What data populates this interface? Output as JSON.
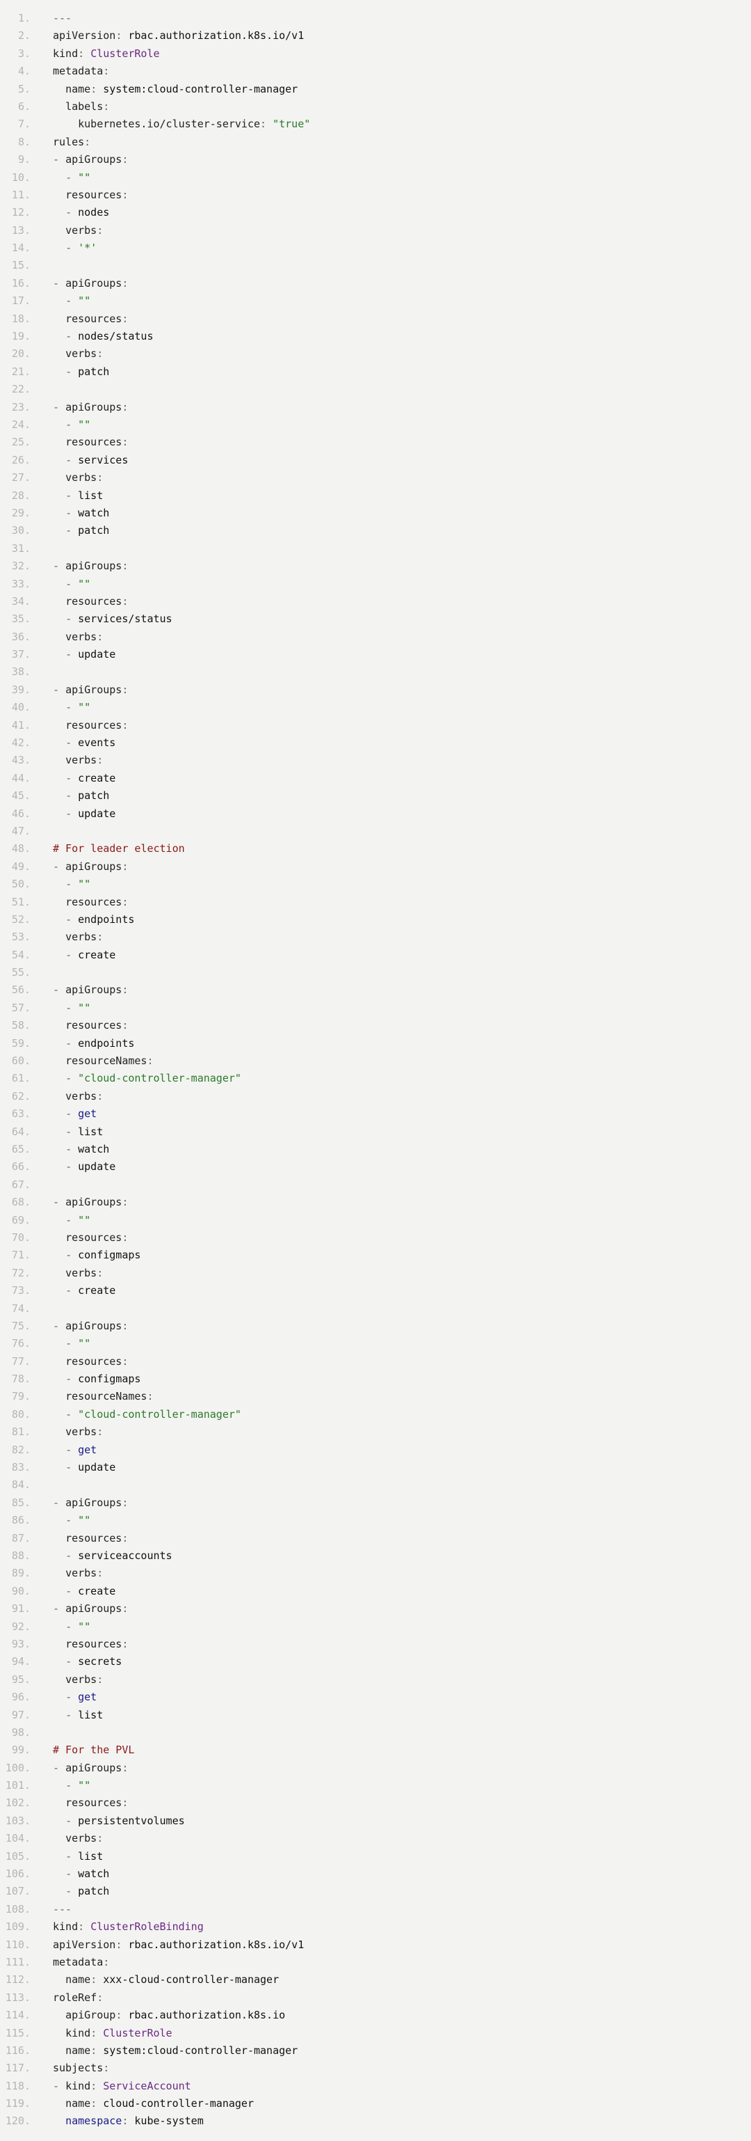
{
  "lines": [
    [
      [
        "punct",
        "---"
      ]
    ],
    [
      [
        "key",
        "apiVersion"
      ],
      [
        "punct",
        ": "
      ],
      [
        "plain",
        "rbac.authorization.k8s.io/v1"
      ]
    ],
    [
      [
        "key",
        "kind"
      ],
      [
        "punct",
        ": "
      ],
      [
        "type",
        "ClusterRole"
      ]
    ],
    [
      [
        "key",
        "metadata"
      ],
      [
        "punct",
        ":"
      ]
    ],
    [
      [
        "plain",
        "  "
      ],
      [
        "key",
        "name"
      ],
      [
        "punct",
        ": "
      ],
      [
        "plain",
        "system:cloud-controller-manager"
      ]
    ],
    [
      [
        "plain",
        "  "
      ],
      [
        "key",
        "labels"
      ],
      [
        "punct",
        ":"
      ]
    ],
    [
      [
        "plain",
        "    "
      ],
      [
        "key",
        "kubernetes.io/cluster-service"
      ],
      [
        "punct",
        ": "
      ],
      [
        "str",
        "\"true\""
      ]
    ],
    [
      [
        "key",
        "rules"
      ],
      [
        "punct",
        ":"
      ]
    ],
    [
      [
        "punct",
        "- "
      ],
      [
        "key",
        "apiGroups"
      ],
      [
        "punct",
        ":"
      ]
    ],
    [
      [
        "plain",
        "  "
      ],
      [
        "punct",
        "- "
      ],
      [
        "str",
        "\"\""
      ]
    ],
    [
      [
        "plain",
        "  "
      ],
      [
        "key",
        "resources"
      ],
      [
        "punct",
        ":"
      ]
    ],
    [
      [
        "plain",
        "  "
      ],
      [
        "punct",
        "- "
      ],
      [
        "plain",
        "nodes"
      ]
    ],
    [
      [
        "plain",
        "  "
      ],
      [
        "key",
        "verbs"
      ],
      [
        "punct",
        ":"
      ]
    ],
    [
      [
        "plain",
        "  "
      ],
      [
        "punct",
        "- "
      ],
      [
        "str",
        "'*'"
      ]
    ],
    [],
    [
      [
        "punct",
        "- "
      ],
      [
        "key",
        "apiGroups"
      ],
      [
        "punct",
        ":"
      ]
    ],
    [
      [
        "plain",
        "  "
      ],
      [
        "punct",
        "- "
      ],
      [
        "str",
        "\"\""
      ]
    ],
    [
      [
        "plain",
        "  "
      ],
      [
        "key",
        "resources"
      ],
      [
        "punct",
        ":"
      ]
    ],
    [
      [
        "plain",
        "  "
      ],
      [
        "punct",
        "- "
      ],
      [
        "plain",
        "nodes/status"
      ]
    ],
    [
      [
        "plain",
        "  "
      ],
      [
        "key",
        "verbs"
      ],
      [
        "punct",
        ":"
      ]
    ],
    [
      [
        "plain",
        "  "
      ],
      [
        "punct",
        "- "
      ],
      [
        "plain",
        "patch"
      ]
    ],
    [],
    [
      [
        "punct",
        "- "
      ],
      [
        "key",
        "apiGroups"
      ],
      [
        "punct",
        ":"
      ]
    ],
    [
      [
        "plain",
        "  "
      ],
      [
        "punct",
        "- "
      ],
      [
        "str",
        "\"\""
      ]
    ],
    [
      [
        "plain",
        "  "
      ],
      [
        "key",
        "resources"
      ],
      [
        "punct",
        ":"
      ]
    ],
    [
      [
        "plain",
        "  "
      ],
      [
        "punct",
        "- "
      ],
      [
        "plain",
        "services"
      ]
    ],
    [
      [
        "plain",
        "  "
      ],
      [
        "key",
        "verbs"
      ],
      [
        "punct",
        ":"
      ]
    ],
    [
      [
        "plain",
        "  "
      ],
      [
        "punct",
        "- "
      ],
      [
        "plain",
        "list"
      ]
    ],
    [
      [
        "plain",
        "  "
      ],
      [
        "punct",
        "- "
      ],
      [
        "plain",
        "watch"
      ]
    ],
    [
      [
        "plain",
        "  "
      ],
      [
        "punct",
        "- "
      ],
      [
        "plain",
        "patch"
      ]
    ],
    [],
    [
      [
        "punct",
        "- "
      ],
      [
        "key",
        "apiGroups"
      ],
      [
        "punct",
        ":"
      ]
    ],
    [
      [
        "plain",
        "  "
      ],
      [
        "punct",
        "- "
      ],
      [
        "str",
        "\"\""
      ]
    ],
    [
      [
        "plain",
        "  "
      ],
      [
        "key",
        "resources"
      ],
      [
        "punct",
        ":"
      ]
    ],
    [
      [
        "plain",
        "  "
      ],
      [
        "punct",
        "- "
      ],
      [
        "plain",
        "services/status"
      ]
    ],
    [
      [
        "plain",
        "  "
      ],
      [
        "key",
        "verbs"
      ],
      [
        "punct",
        ":"
      ]
    ],
    [
      [
        "plain",
        "  "
      ],
      [
        "punct",
        "- "
      ],
      [
        "plain",
        "update"
      ]
    ],
    [],
    [
      [
        "punct",
        "- "
      ],
      [
        "key",
        "apiGroups"
      ],
      [
        "punct",
        ":"
      ]
    ],
    [
      [
        "plain",
        "  "
      ],
      [
        "punct",
        "- "
      ],
      [
        "str",
        "\"\""
      ]
    ],
    [
      [
        "plain",
        "  "
      ],
      [
        "key",
        "resources"
      ],
      [
        "punct",
        ":"
      ]
    ],
    [
      [
        "plain",
        "  "
      ],
      [
        "punct",
        "- "
      ],
      [
        "plain",
        "events"
      ]
    ],
    [
      [
        "plain",
        "  "
      ],
      [
        "key",
        "verbs"
      ],
      [
        "punct",
        ":"
      ]
    ],
    [
      [
        "plain",
        "  "
      ],
      [
        "punct",
        "- "
      ],
      [
        "plain",
        "create"
      ]
    ],
    [
      [
        "plain",
        "  "
      ],
      [
        "punct",
        "- "
      ],
      [
        "plain",
        "patch"
      ]
    ],
    [
      [
        "plain",
        "  "
      ],
      [
        "punct",
        "- "
      ],
      [
        "plain",
        "update"
      ]
    ],
    [],
    [
      [
        "comment",
        "# For leader election"
      ]
    ],
    [
      [
        "punct",
        "- "
      ],
      [
        "key",
        "apiGroups"
      ],
      [
        "punct",
        ":"
      ]
    ],
    [
      [
        "plain",
        "  "
      ],
      [
        "punct",
        "- "
      ],
      [
        "str",
        "\"\""
      ]
    ],
    [
      [
        "plain",
        "  "
      ],
      [
        "key",
        "resources"
      ],
      [
        "punct",
        ":"
      ]
    ],
    [
      [
        "plain",
        "  "
      ],
      [
        "punct",
        "- "
      ],
      [
        "plain",
        "endpoints"
      ]
    ],
    [
      [
        "plain",
        "  "
      ],
      [
        "key",
        "verbs"
      ],
      [
        "punct",
        ":"
      ]
    ],
    [
      [
        "plain",
        "  "
      ],
      [
        "punct",
        "- "
      ],
      [
        "plain",
        "create"
      ]
    ],
    [],
    [
      [
        "punct",
        "- "
      ],
      [
        "key",
        "apiGroups"
      ],
      [
        "punct",
        ":"
      ]
    ],
    [
      [
        "plain",
        "  "
      ],
      [
        "punct",
        "- "
      ],
      [
        "str",
        "\"\""
      ]
    ],
    [
      [
        "plain",
        "  "
      ],
      [
        "key",
        "resources"
      ],
      [
        "punct",
        ":"
      ]
    ],
    [
      [
        "plain",
        "  "
      ],
      [
        "punct",
        "- "
      ],
      [
        "plain",
        "endpoints"
      ]
    ],
    [
      [
        "plain",
        "  "
      ],
      [
        "key",
        "resourceNames"
      ],
      [
        "punct",
        ":"
      ]
    ],
    [
      [
        "plain",
        "  "
      ],
      [
        "punct",
        "- "
      ],
      [
        "str",
        "\"cloud-controller-manager\""
      ]
    ],
    [
      [
        "plain",
        "  "
      ],
      [
        "key",
        "verbs"
      ],
      [
        "punct",
        ":"
      ]
    ],
    [
      [
        "plain",
        "  "
      ],
      [
        "punct",
        "- "
      ],
      [
        "kw",
        "get"
      ]
    ],
    [
      [
        "plain",
        "  "
      ],
      [
        "punct",
        "- "
      ],
      [
        "plain",
        "list"
      ]
    ],
    [
      [
        "plain",
        "  "
      ],
      [
        "punct",
        "- "
      ],
      [
        "plain",
        "watch"
      ]
    ],
    [
      [
        "plain",
        "  "
      ],
      [
        "punct",
        "- "
      ],
      [
        "plain",
        "update"
      ]
    ],
    [],
    [
      [
        "punct",
        "- "
      ],
      [
        "key",
        "apiGroups"
      ],
      [
        "punct",
        ":"
      ]
    ],
    [
      [
        "plain",
        "  "
      ],
      [
        "punct",
        "- "
      ],
      [
        "str",
        "\"\""
      ]
    ],
    [
      [
        "plain",
        "  "
      ],
      [
        "key",
        "resources"
      ],
      [
        "punct",
        ":"
      ]
    ],
    [
      [
        "plain",
        "  "
      ],
      [
        "punct",
        "- "
      ],
      [
        "plain",
        "configmaps"
      ]
    ],
    [
      [
        "plain",
        "  "
      ],
      [
        "key",
        "verbs"
      ],
      [
        "punct",
        ":"
      ]
    ],
    [
      [
        "plain",
        "  "
      ],
      [
        "punct",
        "- "
      ],
      [
        "plain",
        "create"
      ]
    ],
    [],
    [
      [
        "punct",
        "- "
      ],
      [
        "key",
        "apiGroups"
      ],
      [
        "punct",
        ":"
      ]
    ],
    [
      [
        "plain",
        "  "
      ],
      [
        "punct",
        "- "
      ],
      [
        "str",
        "\"\""
      ]
    ],
    [
      [
        "plain",
        "  "
      ],
      [
        "key",
        "resources"
      ],
      [
        "punct",
        ":"
      ]
    ],
    [
      [
        "plain",
        "  "
      ],
      [
        "punct",
        "- "
      ],
      [
        "plain",
        "configmaps"
      ]
    ],
    [
      [
        "plain",
        "  "
      ],
      [
        "key",
        "resourceNames"
      ],
      [
        "punct",
        ":"
      ]
    ],
    [
      [
        "plain",
        "  "
      ],
      [
        "punct",
        "- "
      ],
      [
        "str",
        "\"cloud-controller-manager\""
      ]
    ],
    [
      [
        "plain",
        "  "
      ],
      [
        "key",
        "verbs"
      ],
      [
        "punct",
        ":"
      ]
    ],
    [
      [
        "plain",
        "  "
      ],
      [
        "punct",
        "- "
      ],
      [
        "kw",
        "get"
      ]
    ],
    [
      [
        "plain",
        "  "
      ],
      [
        "punct",
        "- "
      ],
      [
        "plain",
        "update"
      ]
    ],
    [],
    [
      [
        "punct",
        "- "
      ],
      [
        "key",
        "apiGroups"
      ],
      [
        "punct",
        ":"
      ]
    ],
    [
      [
        "plain",
        "  "
      ],
      [
        "punct",
        "- "
      ],
      [
        "str",
        "\"\""
      ]
    ],
    [
      [
        "plain",
        "  "
      ],
      [
        "key",
        "resources"
      ],
      [
        "punct",
        ":"
      ]
    ],
    [
      [
        "plain",
        "  "
      ],
      [
        "punct",
        "- "
      ],
      [
        "plain",
        "serviceaccounts"
      ]
    ],
    [
      [
        "plain",
        "  "
      ],
      [
        "key",
        "verbs"
      ],
      [
        "punct",
        ":"
      ]
    ],
    [
      [
        "plain",
        "  "
      ],
      [
        "punct",
        "- "
      ],
      [
        "plain",
        "create"
      ]
    ],
    [
      [
        "punct",
        "- "
      ],
      [
        "key",
        "apiGroups"
      ],
      [
        "punct",
        ":"
      ]
    ],
    [
      [
        "plain",
        "  "
      ],
      [
        "punct",
        "- "
      ],
      [
        "str",
        "\"\""
      ]
    ],
    [
      [
        "plain",
        "  "
      ],
      [
        "key",
        "resources"
      ],
      [
        "punct",
        ":"
      ]
    ],
    [
      [
        "plain",
        "  "
      ],
      [
        "punct",
        "- "
      ],
      [
        "plain",
        "secrets"
      ]
    ],
    [
      [
        "plain",
        "  "
      ],
      [
        "key",
        "verbs"
      ],
      [
        "punct",
        ":"
      ]
    ],
    [
      [
        "plain",
        "  "
      ],
      [
        "punct",
        "- "
      ],
      [
        "kw",
        "get"
      ]
    ],
    [
      [
        "plain",
        "  "
      ],
      [
        "punct",
        "- "
      ],
      [
        "plain",
        "list"
      ]
    ],
    [],
    [
      [
        "comment",
        "# For the PVL"
      ]
    ],
    [
      [
        "punct",
        "- "
      ],
      [
        "key",
        "apiGroups"
      ],
      [
        "punct",
        ":"
      ]
    ],
    [
      [
        "plain",
        "  "
      ],
      [
        "punct",
        "- "
      ],
      [
        "str",
        "\"\""
      ]
    ],
    [
      [
        "plain",
        "  "
      ],
      [
        "key",
        "resources"
      ],
      [
        "punct",
        ":"
      ]
    ],
    [
      [
        "plain",
        "  "
      ],
      [
        "punct",
        "- "
      ],
      [
        "plain",
        "persistentvolumes"
      ]
    ],
    [
      [
        "plain",
        "  "
      ],
      [
        "key",
        "verbs"
      ],
      [
        "punct",
        ":"
      ]
    ],
    [
      [
        "plain",
        "  "
      ],
      [
        "punct",
        "- "
      ],
      [
        "plain",
        "list"
      ]
    ],
    [
      [
        "plain",
        "  "
      ],
      [
        "punct",
        "- "
      ],
      [
        "plain",
        "watch"
      ]
    ],
    [
      [
        "plain",
        "  "
      ],
      [
        "punct",
        "- "
      ],
      [
        "plain",
        "patch"
      ]
    ],
    [
      [
        "punct",
        "---"
      ]
    ],
    [
      [
        "key",
        "kind"
      ],
      [
        "punct",
        ": "
      ],
      [
        "type",
        "ClusterRoleBinding"
      ]
    ],
    [
      [
        "key",
        "apiVersion"
      ],
      [
        "punct",
        ": "
      ],
      [
        "plain",
        "rbac.authorization.k8s.io/v1"
      ]
    ],
    [
      [
        "key",
        "metadata"
      ],
      [
        "punct",
        ":"
      ]
    ],
    [
      [
        "plain",
        "  "
      ],
      [
        "key",
        "name"
      ],
      [
        "punct",
        ": "
      ],
      [
        "plain",
        "xxx-cloud-controller-manager"
      ]
    ],
    [
      [
        "key",
        "roleRef"
      ],
      [
        "punct",
        ":"
      ]
    ],
    [
      [
        "plain",
        "  "
      ],
      [
        "key",
        "apiGroup"
      ],
      [
        "punct",
        ": "
      ],
      [
        "plain",
        "rbac.authorization.k8s.io"
      ]
    ],
    [
      [
        "plain",
        "  "
      ],
      [
        "key",
        "kind"
      ],
      [
        "punct",
        ": "
      ],
      [
        "type",
        "ClusterRole"
      ]
    ],
    [
      [
        "plain",
        "  "
      ],
      [
        "key",
        "name"
      ],
      [
        "punct",
        ": "
      ],
      [
        "plain",
        "system:cloud-controller-manager"
      ]
    ],
    [
      [
        "key",
        "subjects"
      ],
      [
        "punct",
        ":"
      ]
    ],
    [
      [
        "punct",
        "- "
      ],
      [
        "key",
        "kind"
      ],
      [
        "punct",
        ": "
      ],
      [
        "type",
        "ServiceAccount"
      ]
    ],
    [
      [
        "plain",
        "  "
      ],
      [
        "key",
        "name"
      ],
      [
        "punct",
        ": "
      ],
      [
        "plain",
        "cloud-controller-manager"
      ]
    ],
    [
      [
        "plain",
        "  "
      ],
      [
        "kw",
        "namespace"
      ],
      [
        "punct",
        ": "
      ],
      [
        "plain",
        "kube-system"
      ]
    ]
  ]
}
